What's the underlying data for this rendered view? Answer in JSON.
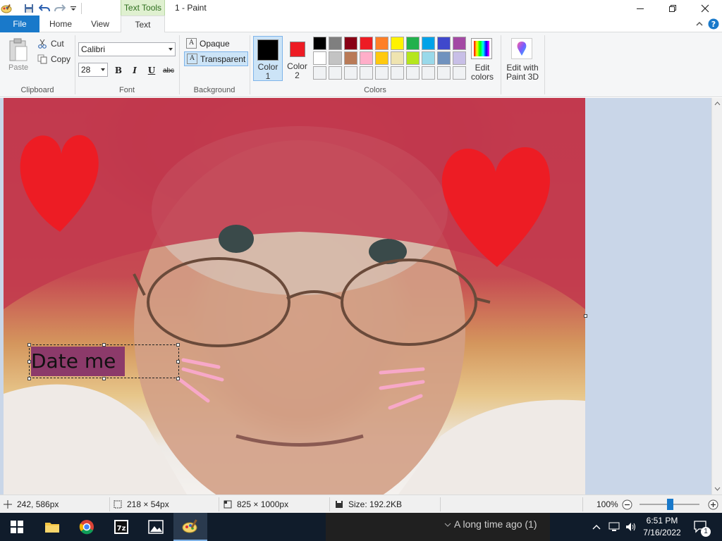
{
  "window": {
    "title": "1 - Paint",
    "context_tab": "Text Tools"
  },
  "tabs": {
    "file": "File",
    "home": "Home",
    "view": "View",
    "text": "Text"
  },
  "clipboard": {
    "paste": "Paste",
    "cut": "Cut",
    "copy": "Copy",
    "label": "Clipboard"
  },
  "font": {
    "family": "Calibri",
    "size": "28",
    "bold": "B",
    "italic": "I",
    "underline": "U",
    "strike": "abc",
    "label": "Font"
  },
  "background": {
    "opaque": "Opaque",
    "transparent": "Transparent",
    "label": "Background",
    "icon_glyph": "A"
  },
  "colors": {
    "color1_line1": "Color",
    "color1_line2": "1",
    "color2_line1": "Color",
    "color2_line2": "2",
    "color1_value": "#000000",
    "color2_value": "#ed1c24",
    "edit_line1": "Edit",
    "edit_line2": "colors",
    "paint3d_line1": "Edit with",
    "paint3d_line2": "Paint 3D",
    "label": "Colors",
    "palette_row1": [
      "#000000",
      "#7f7f7f",
      "#880015",
      "#ed1c24",
      "#ff7f27",
      "#fff200",
      "#22b14c",
      "#00a2e8",
      "#3f48cc",
      "#a349a4"
    ],
    "palette_row2": [
      "#ffffff",
      "#c3c3c3",
      "#b97a57",
      "#ffaec9",
      "#ffc90e",
      "#efe4b0",
      "#b5e61d",
      "#99d9ea",
      "#7092be",
      "#c8bfe7"
    ],
    "palette_row3": [
      "#f0f2f4",
      "#f0f2f4",
      "#f0f2f4",
      "#f0f2f4",
      "#f0f2f4",
      "#f0f2f4",
      "#f0f2f4",
      "#f0f2f4",
      "#f0f2f4",
      "#f0f2f4"
    ]
  },
  "canvas": {
    "text": "Date me",
    "heart_color": "#ed1c24",
    "blush_color": "#f7a8c8"
  },
  "status": {
    "cursor": "242, 586px",
    "selection": "218 × 54px",
    "image_size": "825 × 1000px",
    "file_size": "Size: 192.2KB",
    "zoom": "100%"
  },
  "taskbar": {
    "peek_text": "A long time ago (1)",
    "time": "6:51 PM",
    "date": "7/16/2022",
    "notifications": "1"
  }
}
